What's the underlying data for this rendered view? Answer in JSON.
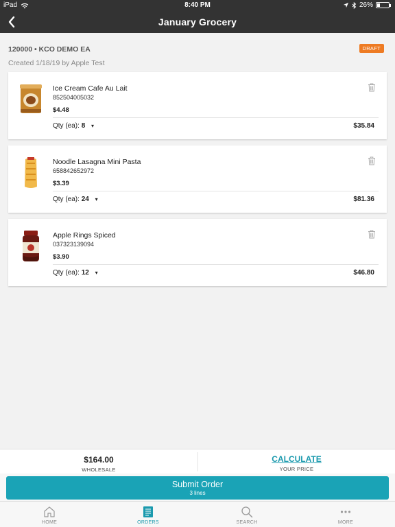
{
  "status_bar": {
    "device": "iPad",
    "time": "8:40 PM",
    "battery": "26%",
    "battery_level": 0.26
  },
  "nav": {
    "title": "January Grocery"
  },
  "order": {
    "account": "120000 • KCO DEMO EA",
    "created": "Created 1/18/19 by Apple Test",
    "status": "DRAFT"
  },
  "colors": {
    "accent": "#1aa3b6",
    "badge": "#ee7b23",
    "header_bg": "#333333"
  },
  "qty_label": "Qty (ea):",
  "items": [
    {
      "name": "Ice Cream Cafe Au Lait",
      "upc": "852504005032",
      "price": "$4.48",
      "qty": "8",
      "total": "$35.84"
    },
    {
      "name": "Noodle Lasagna Mini Pasta",
      "upc": "658842652972",
      "price": "$3.39",
      "qty": "24",
      "total": "$81.36"
    },
    {
      "name": "Apple Rings Spiced",
      "upc": "037323139094",
      "price": "$3.90",
      "qty": "12",
      "total": "$46.80"
    }
  ],
  "summary": {
    "wholesale_value": "$164.00",
    "wholesale_label": "WHOLESALE",
    "calculate_label": "CALCULATE",
    "your_price_label": "YOUR PRICE"
  },
  "submit": {
    "label": "Submit Order",
    "sub": "3 lines"
  },
  "tabs": [
    {
      "label": "HOME",
      "icon": "home-icon"
    },
    {
      "label": "ORDERS",
      "icon": "orders-icon"
    },
    {
      "label": "SEARCH",
      "icon": "search-icon"
    },
    {
      "label": "MORE",
      "icon": "more-icon"
    }
  ]
}
